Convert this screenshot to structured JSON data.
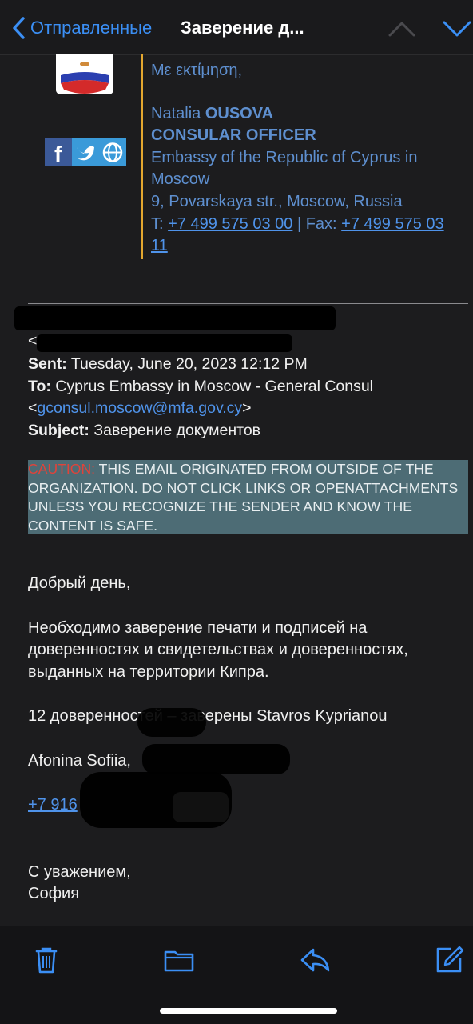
{
  "nav": {
    "back_label": "Отправленные",
    "title": "Заверение д..."
  },
  "signature": {
    "greeting": "Με εκτίμηση,",
    "first_name": "Natalia",
    "last_name": "OUSOVA",
    "position": "CONSULAR OFFICER",
    "organization": "Embassy of the Republic of Cyprus in Moscow",
    "address": "9, Povarskaya str., Moscow, Russia",
    "phone_prefix": "T:",
    "phone": "+7 499 575 03 00",
    "fax_prefix": "| Fax:",
    "fax": "+7 499 575 03 11"
  },
  "header": {
    "from_open": "<",
    "sent_label": "Sent:",
    "sent_value": "Tuesday, June 20, 2023 12:12 PM",
    "to_label": "To:",
    "to_value": "Cyprus Embassy in Moscow - General Consul",
    "to_email_open": "<",
    "to_email": "gconsul.moscow@mfa.gov.cy",
    "to_email_close": ">",
    "subject_label": "Subject:",
    "subject_value": "Заверение документов"
  },
  "caution": {
    "label": "CAUTION:",
    "text": "THIS EMAIL ORIGINATED FROM OUTSIDE OF THE ORGANIZATION. DO NOT CLICK LINKS OR OPENATTACHMENTS UNLESS YOU RECOGNIZE THE SENDER AND KNOW THE CONTENT IS SAFE."
  },
  "body": {
    "greeting": "Добрый день,",
    "paragraph": "Необходимо заверение печати  и подписей на доверенностях и свидетельствах и доверенностях, выданных на территории Кипра.",
    "count_line": "12 доверенностей – заверены Stavros Kyprianou",
    "name_line": "Afonina Sofiia,",
    "phone": "+7 916",
    "closing": "С уважением,",
    "signoff": "София"
  },
  "toolbar": {
    "icons": [
      "trash-icon",
      "folder-icon",
      "reply-icon",
      "compose-icon"
    ]
  },
  "colors": {
    "accent": "#3b8ff5",
    "signature_blue": "#5e8fcf",
    "caution_bg": "#4d6c75",
    "caution_red": "#e0433a",
    "signature_bar": "#e3a72f"
  }
}
